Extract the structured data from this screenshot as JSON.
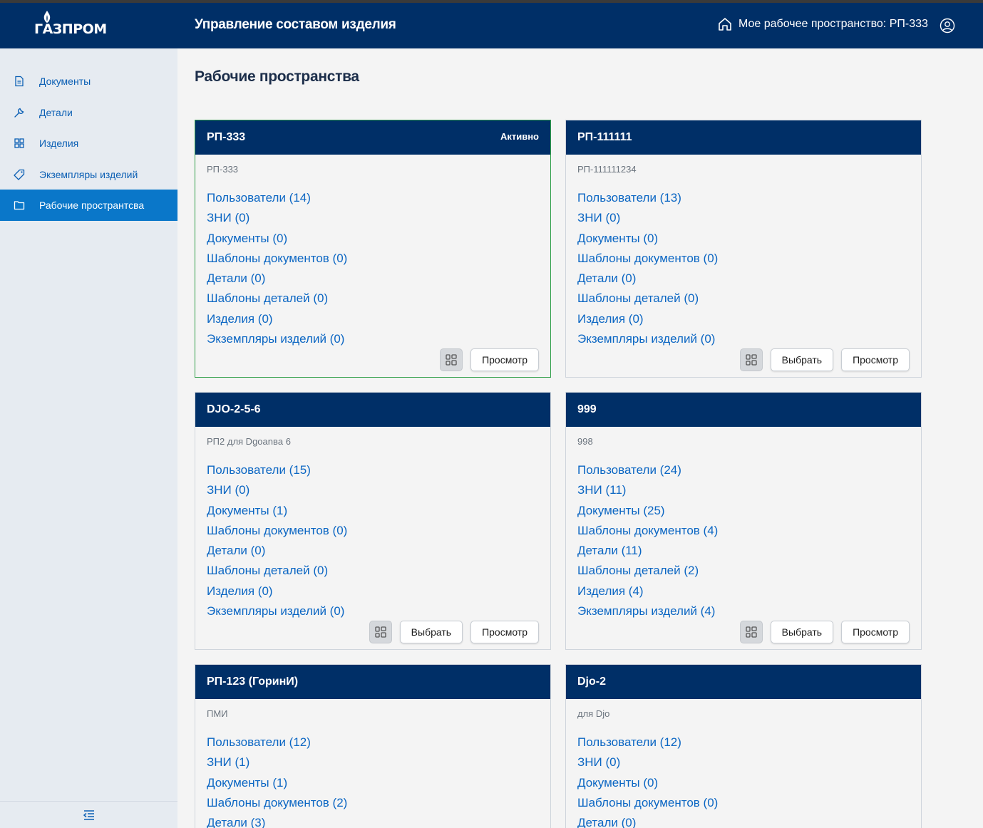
{
  "header": {
    "logo_text": "ГАЗПРОМ",
    "app_title": "Управление составом изделия",
    "workspace_label": "Мое рабочее пространство: РП-333"
  },
  "sidebar": {
    "items": [
      {
        "label": "Документы",
        "icon": "document-icon"
      },
      {
        "label": "Детали",
        "icon": "wrench-icon"
      },
      {
        "label": "Изделия",
        "icon": "grid-icon"
      },
      {
        "label": "Экземпляры изделий",
        "icon": "tag-icon"
      },
      {
        "label": "Рабочие пространтсва",
        "icon": "folder-icon",
        "active": true
      }
    ],
    "collapse_icon": "collapse-menu-icon"
  },
  "main": {
    "title": "Рабочие пространства",
    "cards": [
      {
        "name": "РП-333",
        "status": "Активно",
        "description": "РП-333",
        "links": [
          "Пользователи (14)",
          "ЗНИ (0)",
          "Документы (0)",
          "Шаблоны документов (0)",
          "Детали (0)",
          "Шаблоны деталей (0)",
          "Изделия (0)",
          "Экземпляры изделий (0)"
        ],
        "select_label": "",
        "view_label": "Просмотр"
      },
      {
        "name": "РП-111111",
        "status": "",
        "description": "РП-111111234",
        "links": [
          "Пользователи (13)",
          "ЗНИ (0)",
          "Документы (0)",
          "Шаблоны документов (0)",
          "Детали (0)",
          "Шаблоны деталей (0)",
          "Изделия (0)",
          "Экземпляры изделий (0)"
        ],
        "select_label": "Выбрать",
        "view_label": "Просмотр"
      },
      {
        "name": "DJO-2-5-6",
        "status": "",
        "description": "РП2 для Dgoanвa 6",
        "links": [
          "Пользователи (15)",
          "ЗНИ (0)",
          "Документы (1)",
          "Шаблоны документов (0)",
          "Детали (0)",
          "Шаблоны деталей (0)",
          "Изделия (0)",
          "Экземпляры изделий (0)"
        ],
        "select_label": "Выбрать",
        "view_label": "Просмотр"
      },
      {
        "name": "999",
        "status": "",
        "description": "998",
        "links": [
          "Пользователи (24)",
          "ЗНИ (11)",
          "Документы (25)",
          "Шаблоны документов (4)",
          "Детали (11)",
          "Шаблоны деталей (2)",
          "Изделия (4)",
          "Экземпляры изделий (4)"
        ],
        "select_label": "Выбрать",
        "view_label": "Просмотр"
      },
      {
        "name": "РП-123 (ГоринИ)",
        "status": "",
        "description": "ПМИ",
        "links": [
          "Пользователи (12)",
          "ЗНИ (1)",
          "Документы (1)",
          "Шаблоны документов (2)",
          "Детали (3)"
        ],
        "select_label": "",
        "view_label": ""
      },
      {
        "name": "Djo-2",
        "status": "",
        "description": "для Djo",
        "links": [
          "Пользователи (12)",
          "ЗНИ (0)",
          "Документы (0)",
          "Шаблоны документов (0)",
          "Детали (0)"
        ],
        "select_label": "",
        "view_label": ""
      }
    ]
  },
  "colors": {
    "header_bg": "#002f67",
    "sidebar_bg": "#e6ebf1",
    "active_nav": "#0a77c9",
    "link": "#0b66c3",
    "active_card_border": "#2e9e48"
  }
}
